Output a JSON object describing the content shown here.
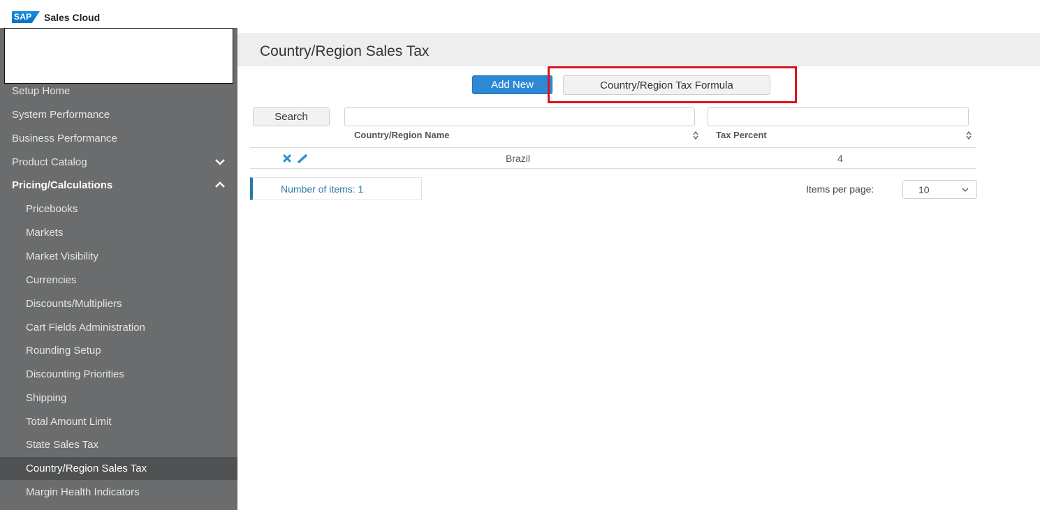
{
  "app": {
    "logo": "SAP",
    "product": "Sales Cloud"
  },
  "sidebar": {
    "items": [
      {
        "label": "Setup Home"
      },
      {
        "label": "System Performance"
      },
      {
        "label": "Business Performance"
      },
      {
        "label": "Product Catalog"
      },
      {
        "label": "Pricing/Calculations"
      },
      {
        "label": "Pricebooks"
      },
      {
        "label": "Markets"
      },
      {
        "label": "Market Visibility"
      },
      {
        "label": "Currencies"
      },
      {
        "label": "Discounts/Multipliers"
      },
      {
        "label": "Cart Fields Administration"
      },
      {
        "label": "Rounding Setup"
      },
      {
        "label": "Discounting Priorities"
      },
      {
        "label": "Shipping"
      },
      {
        "label": "Total Amount Limit"
      },
      {
        "label": "State Sales Tax"
      },
      {
        "label": "Country/Region Sales Tax"
      },
      {
        "label": "Margin Health Indicators"
      }
    ]
  },
  "page": {
    "title": "Country/Region Sales Tax"
  },
  "toolbar": {
    "add_new": "Add New",
    "tax_formula": "Country/Region Tax Formula"
  },
  "search": {
    "button": "Search",
    "filter1_value": "",
    "filter2_value": ""
  },
  "table": {
    "columns": [
      "Country/Region Name",
      "Tax Percent"
    ],
    "rows": [
      {
        "name": "Brazil",
        "tax": "4"
      }
    ]
  },
  "footer": {
    "count_label": "Number of items: 1",
    "items_per_page_label": "Items per page:",
    "items_per_page_value": "10"
  },
  "colors": {
    "primary": "#2d88d6",
    "highlight": "#e0121b",
    "sidebar": "#6a6c6d"
  }
}
